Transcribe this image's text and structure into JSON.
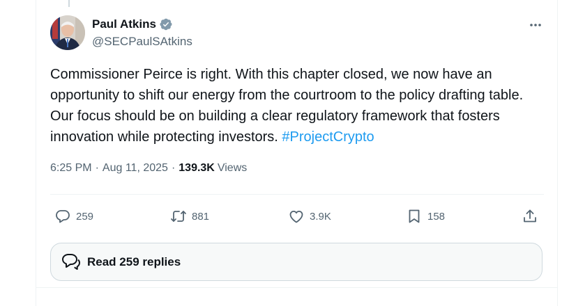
{
  "author": {
    "display_name": "Paul Atkins",
    "handle": "@SECPaulSAtkins",
    "verified": true
  },
  "tweet": {
    "text_before_hashtag": "Commissioner Peirce is right. With this chapter closed, we now have an opportunity to shift our energy from the courtroom to the policy drafting table. Our focus should be on building a clear regulatory framework that fosters innovation while protecting investors. ",
    "hashtag": "#ProjectCrypto"
  },
  "meta": {
    "time": "6:25 PM",
    "separator": "·",
    "date": "Aug 11, 2025",
    "views_count": "139.3K",
    "views_label": "Views"
  },
  "actions": {
    "replies": "259",
    "reposts": "881",
    "likes": "3.9K",
    "bookmarks": "158"
  },
  "read_replies": {
    "label": "Read 259 replies"
  },
  "icons": {
    "verified": "verified-badge-icon",
    "more": "more-dots-icon",
    "reply": "reply-icon",
    "repost": "repost-icon",
    "like": "heart-icon",
    "bookmark": "bookmark-icon",
    "share": "share-icon",
    "replies_bubble": "speech-bubbles-icon"
  },
  "colors": {
    "accent": "#1d9bf0",
    "text_primary": "#0f1419",
    "text_secondary": "#536471",
    "border": "#eff3f4"
  }
}
